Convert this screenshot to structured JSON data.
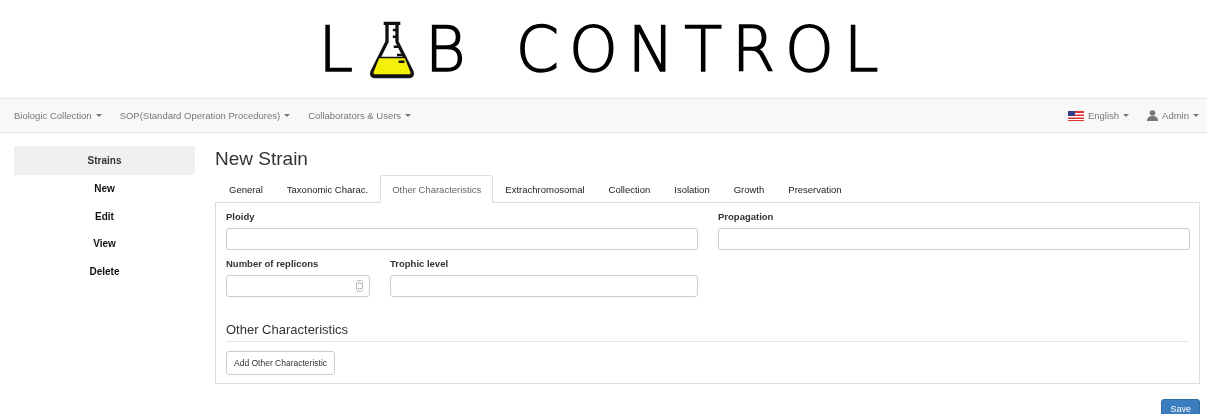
{
  "logo": {
    "before": "L",
    "after": "B",
    "word": "CONTROL"
  },
  "navbar": {
    "menus": [
      {
        "label": "Biologic Collection"
      },
      {
        "label": "SOP(Standard Operation Procedures)"
      },
      {
        "label": "Collaborators & Users"
      }
    ],
    "right": [
      {
        "kind": "language",
        "label": "English"
      },
      {
        "kind": "user",
        "label": "Admin"
      }
    ]
  },
  "sidebar": {
    "header": "Strains",
    "items": [
      {
        "label": "New"
      },
      {
        "label": "Edit"
      },
      {
        "label": "View"
      },
      {
        "label": "Delete"
      }
    ]
  },
  "page_title": "New Strain",
  "tabs": [
    {
      "label": "General",
      "selected": false
    },
    {
      "label": "Taxonomic Charac.",
      "selected": false
    },
    {
      "label": "Other Characteristics",
      "selected": true
    },
    {
      "label": "Extrachromosomal",
      "selected": false
    },
    {
      "label": "Collection",
      "selected": false
    },
    {
      "label": "Isolation",
      "selected": false
    },
    {
      "label": "Growth",
      "selected": false
    },
    {
      "label": "Preservation",
      "selected": false
    }
  ],
  "fields": [
    {
      "label": "Ploidy",
      "kind": "text"
    },
    {
      "label": "Propagation",
      "kind": "text"
    },
    {
      "label": "Number of replicons",
      "kind": "number"
    },
    {
      "label": "Trophic level",
      "kind": "text"
    }
  ],
  "section_title": "Other Characteristics",
  "add_button": "Add Other Characteristic",
  "save_button": "Save"
}
